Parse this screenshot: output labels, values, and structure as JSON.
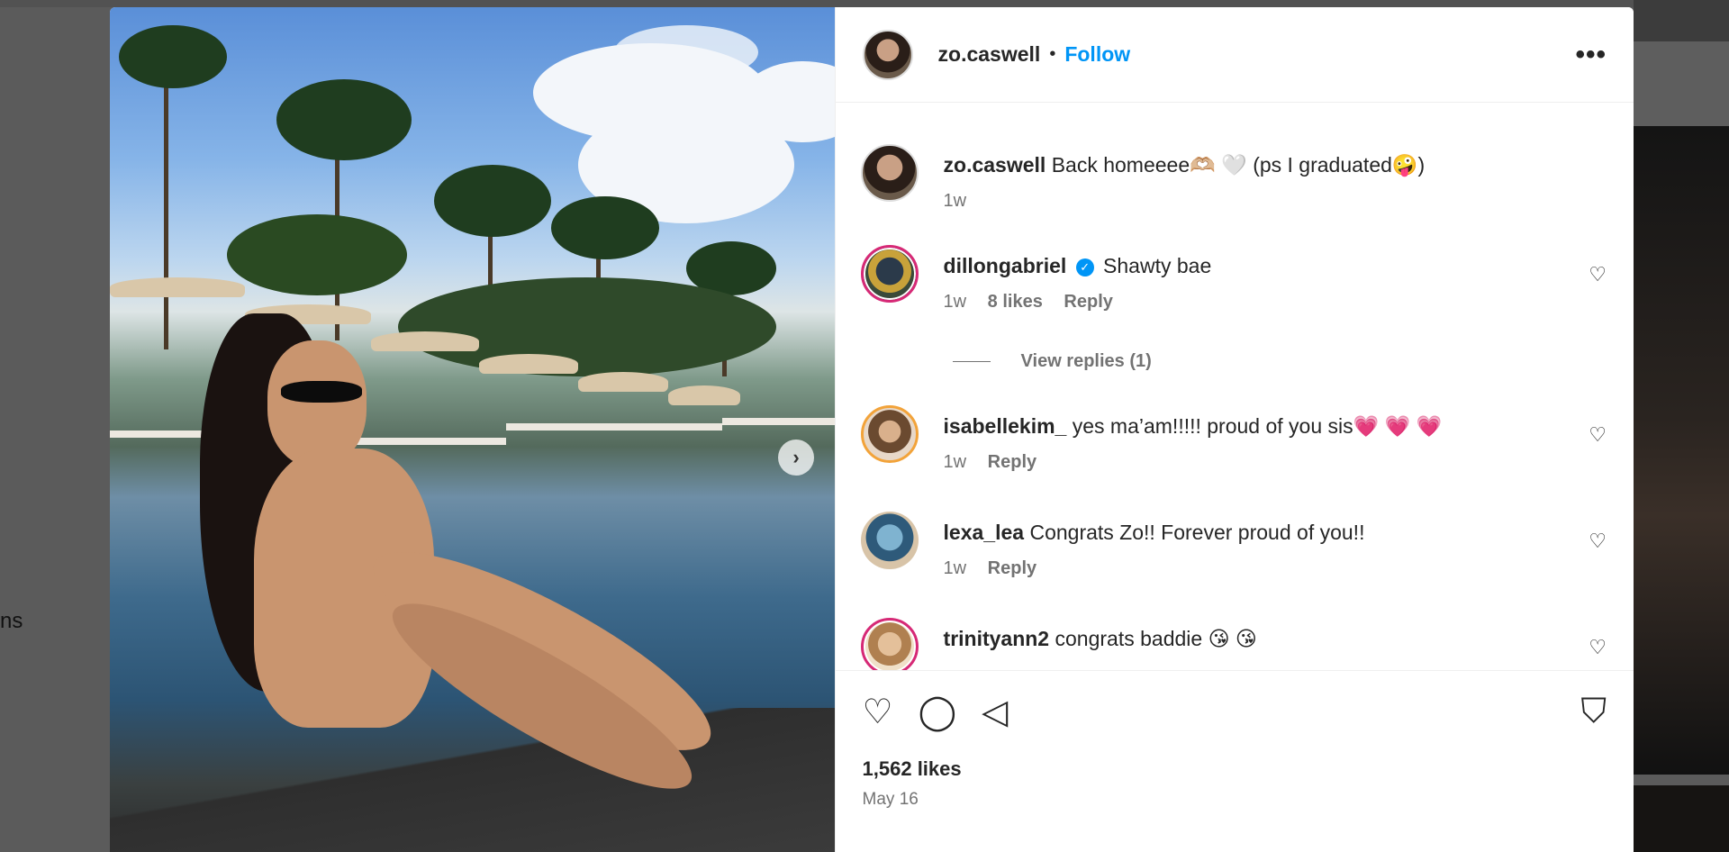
{
  "backdrop": {
    "left_text": "ns"
  },
  "post": {
    "username": "zo.caswell",
    "follow_label": "Follow",
    "separator": "•",
    "more_label": "•••",
    "caption_user": "zo.caswell",
    "caption_text": "Back homeeee🫶🏼 🤍 (ps I graduated🤪)",
    "caption_time": "1w",
    "likes": "1,562 likes",
    "date": "May 16",
    "next_arrow": "›"
  },
  "comments": [
    {
      "user": "dillongabriel",
      "verified": true,
      "text": "Shawty bae",
      "time": "1w",
      "likes": "8 likes",
      "reply": "Reply"
    },
    {
      "user": "isabellekim_",
      "verified": false,
      "text": "yes ma’am!!!!! proud of you sis💗 💗 💗",
      "time": "1w",
      "reply": "Reply"
    },
    {
      "user": "lexa_lea",
      "verified": false,
      "text": "Congrats Zo!! Forever proud of you!!",
      "time": "1w",
      "reply": "Reply"
    },
    {
      "user": "trinityann2",
      "verified": false,
      "text": "congrats baddie 😘 😘"
    }
  ],
  "view_replies": "View replies (1)",
  "icons": {
    "heart": "♡",
    "comment": "◯",
    "share": "◁",
    "save": "⛉",
    "verified": "✓"
  }
}
